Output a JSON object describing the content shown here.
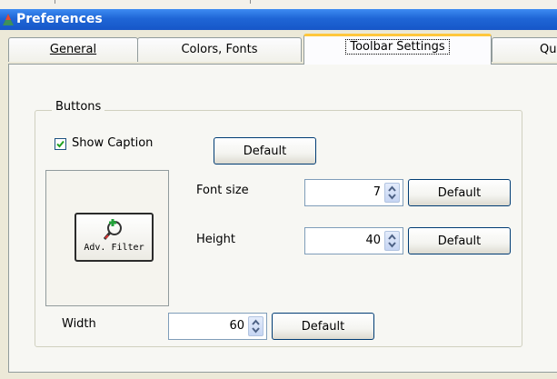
{
  "window": {
    "title": "Preferences"
  },
  "tabs": [
    {
      "label": "General",
      "active": false
    },
    {
      "label": "Colors, Fonts",
      "active": false
    },
    {
      "label": "Toolbar Settings",
      "active": true
    },
    {
      "label": "Quicl",
      "active": false
    }
  ],
  "buttons_group": {
    "label": "Buttons",
    "show_caption": {
      "label": "Show Caption",
      "checked": true
    },
    "caption_default_label": "Default",
    "preview_button": {
      "caption": "Adv. Filter",
      "icon": "adv-filter-icon"
    },
    "font_size": {
      "label": "Font size",
      "value": "7",
      "default_label": "Default"
    },
    "height": {
      "label": "Height",
      "value": "40",
      "default_label": "Default"
    },
    "width": {
      "label": "Width",
      "value": "60",
      "default_label": "Default"
    }
  },
  "colors": {
    "titlebar": "#1f66d6",
    "active_tab_accent": "#ffc73c",
    "check": "#21a121"
  }
}
